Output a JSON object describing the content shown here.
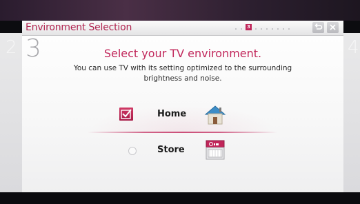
{
  "dialog": {
    "title": "Environment Selection",
    "current_page": "3",
    "back_icon": "back-arrow-icon",
    "close_icon": "close-icon"
  },
  "step": {
    "previous": "2",
    "current": "3",
    "next": "4"
  },
  "content": {
    "heading": "Select your TV environment.",
    "description": "You can use TV with its setting optimized to the surrounding brightness and noise."
  },
  "options": [
    {
      "label": "Home",
      "selected": true,
      "icon": "house-icon"
    },
    {
      "label": "Store",
      "selected": false,
      "icon": "lg-store-icon"
    }
  ],
  "colors": {
    "accent": "#c1265a",
    "title": "#b0234f"
  }
}
